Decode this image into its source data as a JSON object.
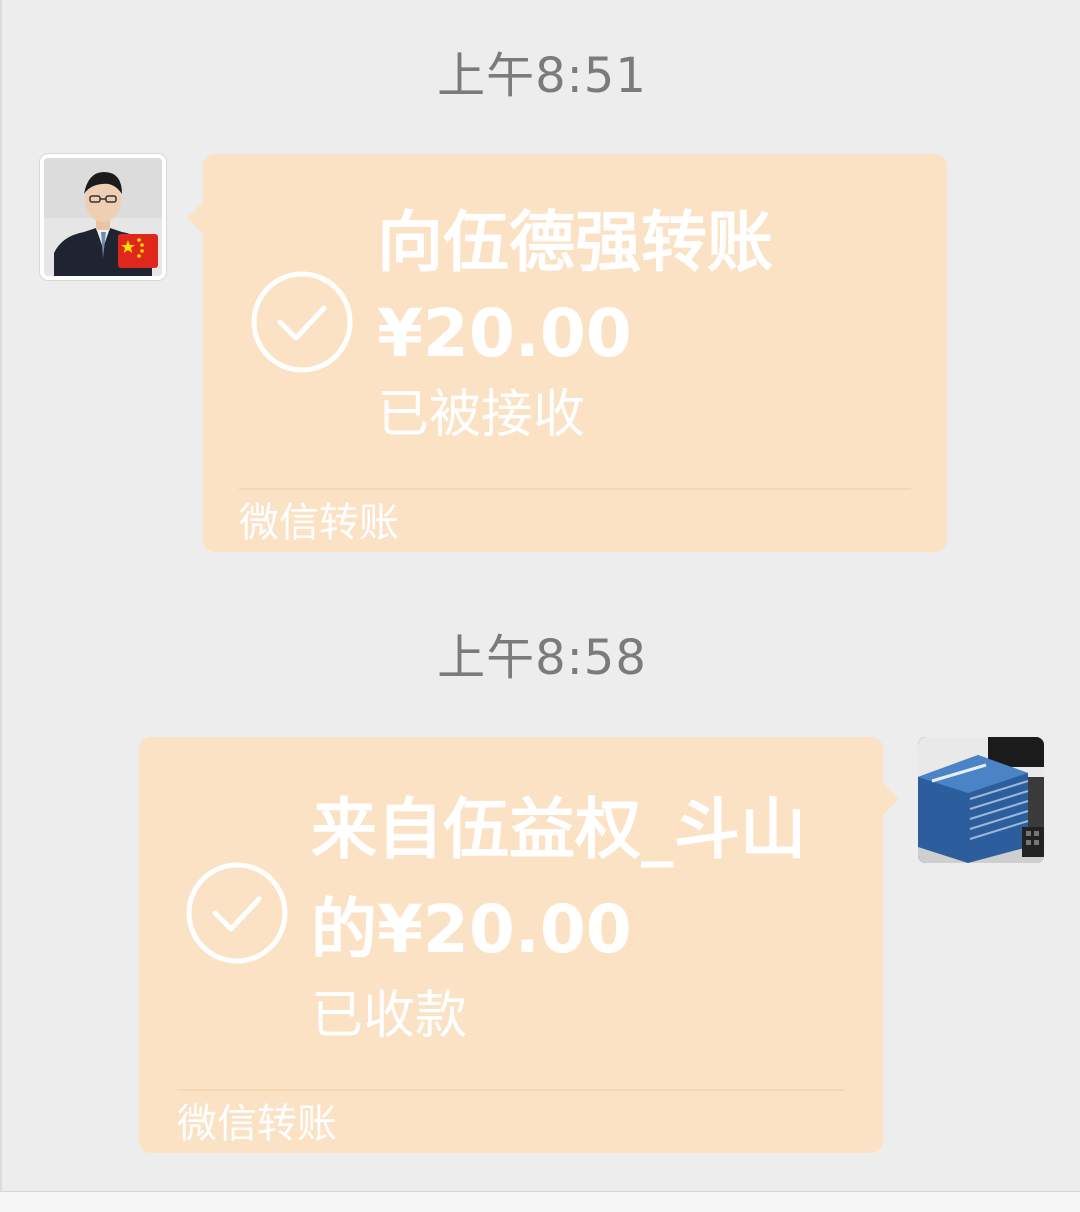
{
  "chat": {
    "messages": [
      {
        "timestamp": "上午8:51",
        "sender": "left",
        "transfer": {
          "title": "向伍德强转账",
          "amount": "¥20.00",
          "status": "已被接收",
          "footer": "微信转账"
        }
      },
      {
        "timestamp": "上午8:58",
        "sender": "right",
        "transfer": {
          "title": "来自伍益权_斗山",
          "amount": "的¥20.00",
          "status": "已收款",
          "footer": "微信转账"
        }
      }
    ]
  },
  "colors": {
    "background": "#ededed",
    "bubble": "#fbe2c5",
    "text": "#ffffff",
    "timestamp": "#7b7b7b"
  },
  "icons": {
    "check": "check-circle-icon",
    "flag": "china-flag-icon"
  }
}
